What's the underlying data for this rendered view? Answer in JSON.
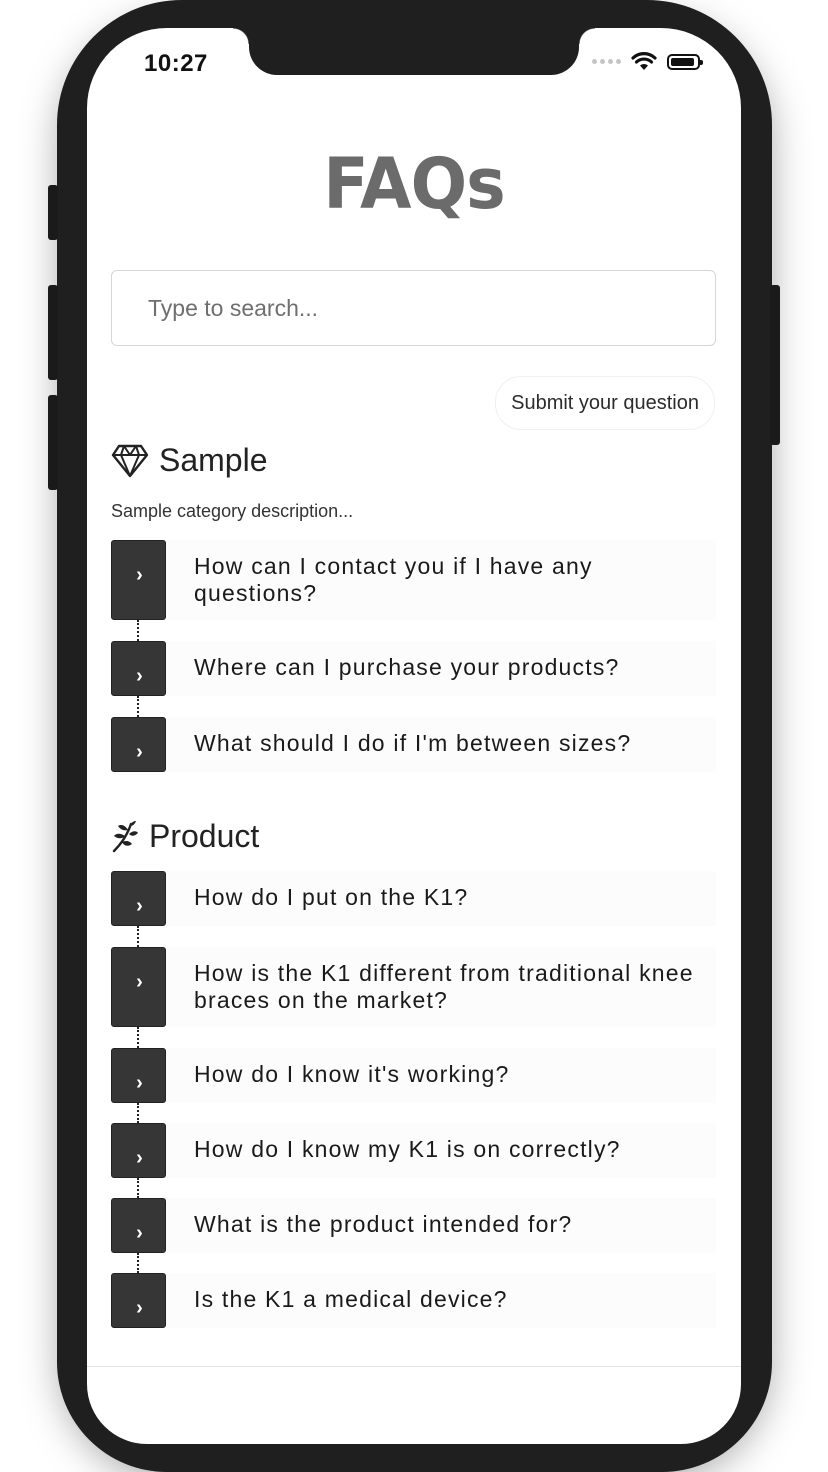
{
  "status_bar": {
    "time": "10:27"
  },
  "header": {
    "title": "FAQs"
  },
  "search": {
    "placeholder": "Type to search..."
  },
  "actions": {
    "submit_label": "Submit your question"
  },
  "categories": [
    {
      "title": "Sample",
      "icon": "diamond-icon",
      "description": "Sample category description...",
      "questions": [
        "How can I contact you if I have any questions?",
        "Where can I purchase your products?",
        "What should I do if I'm between sizes?"
      ]
    },
    {
      "title": "Product",
      "icon": "leaf-icon",
      "description": "",
      "questions": [
        "How do I put on the K1?",
        "How is the K1 different from traditional knee braces on the market?",
        "How do I know it's working?",
        "How do I know my K1 is on correctly?",
        "What is the product intended for?",
        "Is the K1 a medical device?"
      ]
    }
  ],
  "colors": {
    "frame": "#1f1f1f",
    "title": "#6b6b6b",
    "accent_bar": "#363636",
    "item_background": "#fcfcfc"
  },
  "icons": {
    "chevron": "chevron-right-icon"
  }
}
